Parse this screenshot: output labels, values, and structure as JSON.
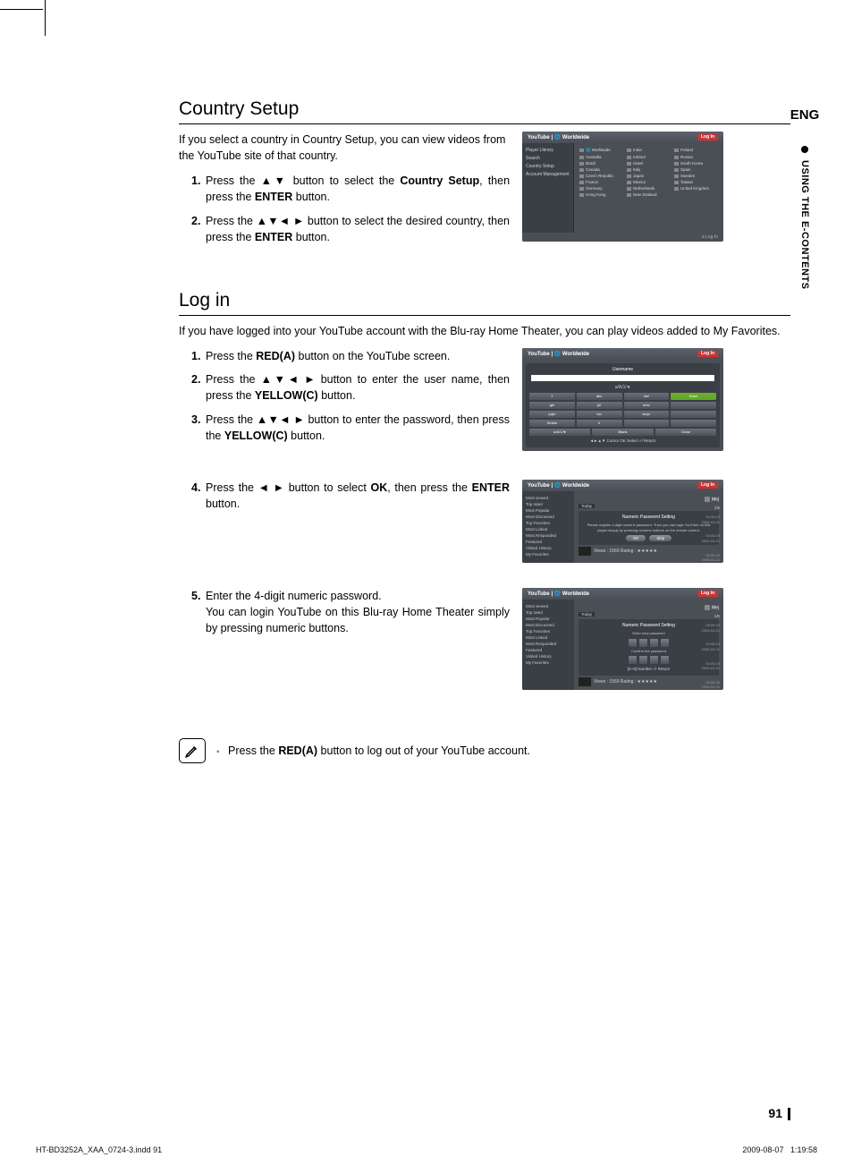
{
  "tab": {
    "lang": "ENG",
    "side_label": "USING THE E-CONTENTS"
  },
  "section1": {
    "heading": "Country Setup",
    "intro": "If you select a country in Country Setup, you can view videos from the YouTube site of that country.",
    "steps": [
      {
        "n": "1.",
        "pre": "Press the ",
        "btn": "▲▼",
        "mid": " button to select the ",
        "bold": "Country Setup",
        "post": ", then press the ",
        "bold2": "ENTER",
        "post2": " button."
      },
      {
        "n": "2.",
        "pre": "Press the ",
        "btn": "▲▼◄ ►",
        "mid": " button to select the desired country, then press the ",
        "bold": "ENTER",
        "post": " button."
      }
    ]
  },
  "section2": {
    "heading": "Log in",
    "intro": "If you have logged into your YouTube account with the Blu-ray Home Theater, you can play videos added to My Favorites.",
    "steps_a": [
      {
        "n": "1.",
        "pre": "Press the ",
        "bold": "RED(A)",
        "post": " button on the YouTube screen."
      },
      {
        "n": "2.",
        "pre": "Press the ",
        "btn": "▲▼◄ ►",
        "mid": " button to enter the user name, then press the ",
        "bold": "YELLOW(C)",
        "post": " button."
      },
      {
        "n": "3.",
        "pre": "Press the ",
        "btn": "▲▼◄ ►",
        "mid": " button to enter the password, then press the ",
        "bold": "YELLOW(C)",
        "post": " button."
      }
    ],
    "steps_b": [
      {
        "n": "4.",
        "pre": "Press the ",
        "btn": "◄ ►",
        "mid": " button to select ",
        "bold": "OK",
        "post": ", then press the ",
        "bold2": "ENTER",
        "post2": " button."
      }
    ],
    "steps_c": [
      {
        "n": "5.",
        "line1": "Enter the 4-digit numeric password.",
        "line2": "You can login YouTube on this Blu-ray Home Theater simply by pressing numeric buttons."
      }
    ]
  },
  "shot_country": {
    "breadcrumb": "YouTube | 🌐 Worldwide",
    "badge": "Log In",
    "sidebar": [
      "Player Library",
      "Search",
      "Country Setup",
      "Account Management"
    ],
    "countries_col1": [
      "🌐 Worldwide",
      "Australia",
      "Brazil",
      "Canada",
      "Czech Republic",
      "France",
      "Germany",
      "Hong Kong"
    ],
    "countries_col2": [
      "India",
      "Ireland",
      "Israel",
      "Italy",
      "Japan",
      "Mexico",
      "Netherlands",
      "New Zealand"
    ],
    "countries_col3": [
      "Poland",
      "Russia",
      "South Korea",
      "Spain",
      "Sweden",
      "Taiwan",
      "United Kingdom"
    ],
    "footer": "a Log In"
  },
  "shot_kbd": {
    "breadcrumb": "YouTube | 🌐 Worldwide",
    "badge": "Log In",
    "title": "Username",
    "sub": "a/A/1/★",
    "keys_r1": [
      "1",
      "abc",
      "def",
      "Done"
    ],
    "keys_r2": [
      "ghi",
      "jkl",
      "mno",
      ""
    ],
    "keys_r3": [
      "pqrs",
      "tuv",
      "wxyz",
      ""
    ],
    "keys_r4": [
      "Delete",
      "0",
      "",
      ""
    ],
    "bottom": [
      "a/A/1/★",
      "Blank",
      "Close"
    ],
    "hint": "◄►▲▼ Cursor  OK Select  ⏎ Return"
  },
  "shot_ok": {
    "breadcrumb": "YouTube | 🌐 Worldwide",
    "badge": "Log In",
    "user": "Mej",
    "count": "1/5",
    "tab": "Today",
    "sidebar": [
      "Most viewed",
      "Top rated",
      "Most Popular",
      "Most Discussed",
      "Top Favorites",
      "Most Linked",
      "Most Responded",
      "Featured",
      "Visited History",
      "My Favorites"
    ],
    "modal_title": "Numeric Password Setting",
    "modal_text": "Please register 4-digit numeric password. Then you can login YouTube on this player simply by pressing numeric buttons on the remote control.",
    "btn_ok": "OK",
    "btn_skip": "Skip",
    "meta_views": "Views : 1569     Rating : ★★★★★",
    "meta_time": "00:06:23",
    "meta_date": "2009-03-21"
  },
  "shot_pw": {
    "breadcrumb": "YouTube | 🌐 Worldwide",
    "badge": "Log In",
    "user": "Mej",
    "count": "1/5",
    "tab": "Today",
    "sidebar": [
      "Most viewed",
      "Top rated",
      "Most Popular",
      "Most Discussed",
      "Top Favorites",
      "Most Linked",
      "Most Responded",
      "Featured",
      "Visited History",
      "My Favorites"
    ],
    "modal_title": "Numeric Password Setting",
    "label1": "Enter new password",
    "label2": "Confirm the password",
    "hint": "[0~9] Number  ⏎ Return",
    "meta_views": "Views : 1569     Rating : ★★★★★",
    "meta_time": "00:06:23",
    "meta_date": "2009-03-21"
  },
  "note": {
    "icon": "✎",
    "bullet": "▪",
    "pre": "Press the ",
    "bold": "RED(A)",
    "post": " button to log out of your YouTube account."
  },
  "page_number": "91",
  "footer": {
    "left": "HT-BD3252A_XAA_0724-3.indd   91",
    "right_date": "2009-08-07",
    "right_time": "1:19:58"
  }
}
